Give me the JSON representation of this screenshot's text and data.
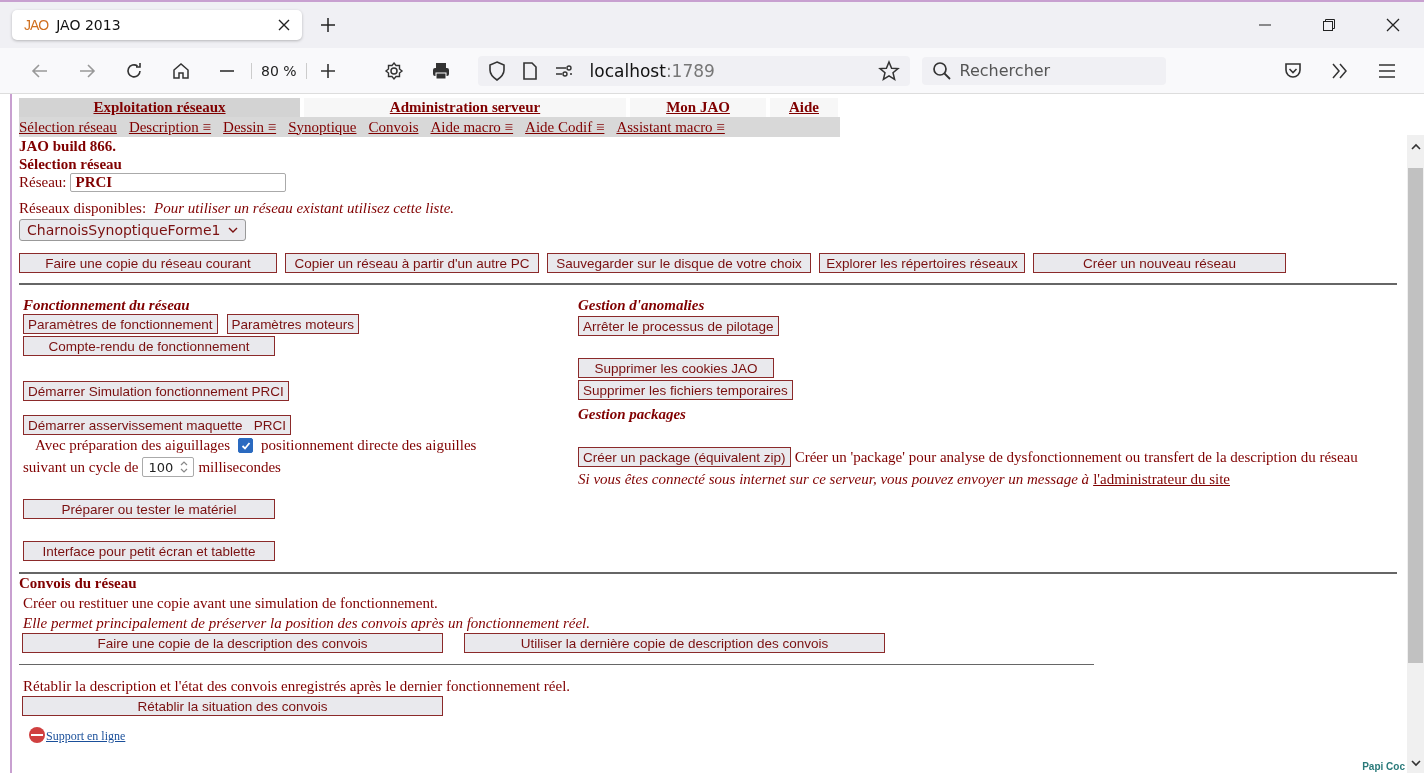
{
  "browser": {
    "tab_logo": "JAO",
    "tab_title": "JAO 2013",
    "zoom": "80 %",
    "url_host": "localhost",
    "url_port": ":1789",
    "search_placeholder": "Rechercher"
  },
  "nav": {
    "tabs": [
      {
        "label": "Exploitation réseaux",
        "selected": true
      },
      {
        "label": "Administration serveur",
        "selected": false
      },
      {
        "label": "Mon JAO",
        "selected": false
      },
      {
        "label": "Aide",
        "selected": false
      }
    ],
    "submenu": [
      "Sélection réseau",
      "Description ≡",
      "Dessin ≡",
      "Synoptique",
      "Convois",
      "Aide macro ≡",
      "Aide Codif ≡",
      "Assistant macro ≡"
    ]
  },
  "header": {
    "build": "JAO build 866.",
    "title": "Sélection réseau",
    "network_label": "Réseau:",
    "network_value": "PRCI",
    "available_label": "Réseaux disponibles:",
    "available_hint": "Pour utiliser un réseau existant utilisez cette liste.",
    "select_value": "CharnoisSynoptiqueForme1",
    "buttons": [
      "Faire une copie du réseau courant",
      "Copier un réseau à partir d'un autre PC",
      "Sauvegarder sur le disque de votre choix",
      "Explorer les répertoires réseaux",
      "Créer un nouveau réseau"
    ]
  },
  "left": {
    "title": "Fonctionnement du réseau",
    "params_buttons": [
      "Paramètres de fonctionnement",
      "Paramètres moteurs"
    ],
    "report_button": "Compte-rendu de fonctionnement",
    "simulation_button": "Démarrer Simulation fonctionnement PRCI",
    "servo_button": "Démarrer asservissement maquette   PRCI",
    "switches": {
      "label_before": "Avec préparation des aiguillages",
      "checked": true,
      "label_after": "positionnement directe des aiguilles"
    },
    "cycle": {
      "label_before": "suivant un cycle de",
      "value": "100",
      "label_after": "millisecondes"
    },
    "hardware_button": "Préparer ou tester le matériel",
    "tablet_button": "Interface pour petit écran et tablette"
  },
  "right": {
    "anomalies_title": "Gestion d'anomalies",
    "stop_button": "Arrêter le processus de pilotage",
    "cookies_button": "Supprimer les cookies JAO",
    "temp_button": "Supprimer les fichiers temporaires",
    "packages_title": "Gestion packages",
    "package_button": "Créer un package (équivalent zip)",
    "package_text": "Créer un 'package' pour analyse de dysfonctionnement ou transfert de la description du réseau",
    "contact_text": "Si vous êtes connecté sous internet sur ce serveur, vous pouvez envoyer un message à",
    "contact_link": "l'administrateur du site"
  },
  "convoys": {
    "title": "Convois du réseau",
    "line1": "Créer ou restituer une copie avant une simulation de fonctionnement.",
    "line2": "Elle permet principalement de préserver la position des convois après un fonctionnement réel.",
    "buttons": [
      "Faire une copie de la description des convois",
      "Utiliser la dernière copie de description des convois"
    ],
    "restore_text": "Rétablir la description et l'état des convois enregistrés après le dernier fonctionnement réel.",
    "restore_button": "Rétablir la situation des convois"
  },
  "footer": {
    "support_link": "Support en ligne",
    "corner_text": "Papi Coc"
  }
}
